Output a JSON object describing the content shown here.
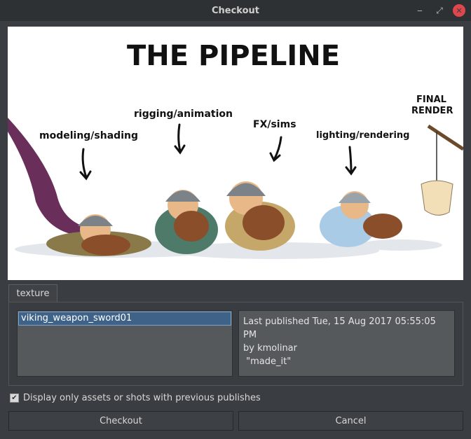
{
  "window": {
    "title": "Checkout"
  },
  "art": {
    "title": "THE PIPELINE",
    "labels": [
      "modeling/shading",
      "rigging/animation",
      "FX/sims",
      "lighting/rendering",
      "FINAL",
      "RENDER"
    ]
  },
  "tabs": [
    {
      "label": "texture"
    }
  ],
  "assets": [
    "viking_weapon_sword01"
  ],
  "info": {
    "line1": "Last published Tue, 15 Aug 2017 05:55:05 PM",
    "line2": "by kmolinar",
    "line3": " \"made_it\""
  },
  "filter": {
    "label": "Display only assets or shots with previous publishes",
    "checked": true
  },
  "buttons": {
    "checkout": "Checkout",
    "cancel": "Cancel"
  },
  "colors": {
    "selection": "#3f6289",
    "close": "#e0474c"
  }
}
